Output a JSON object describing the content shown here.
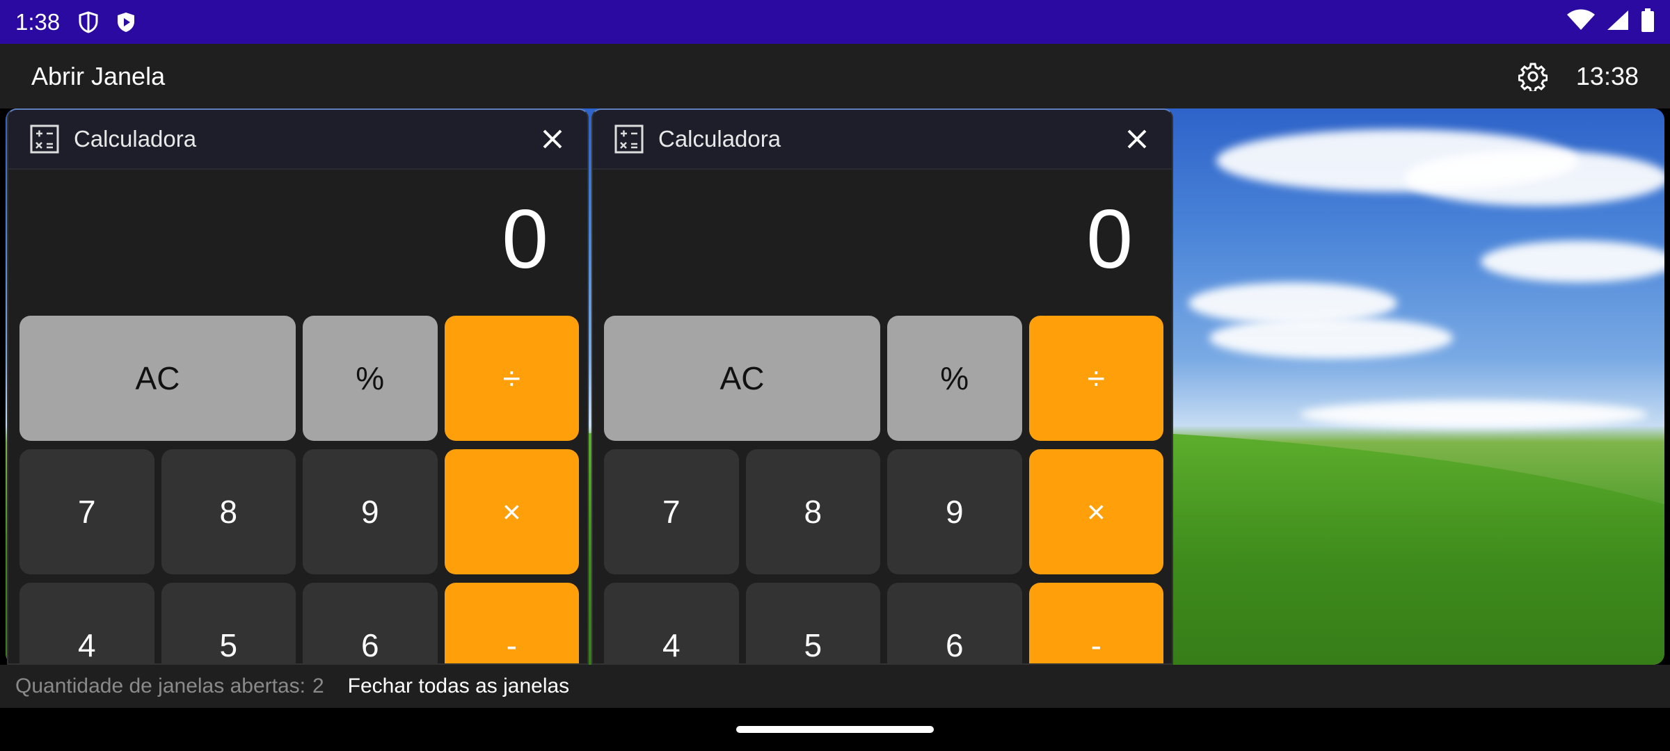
{
  "status_bar": {
    "time": "1:38",
    "icons_left": [
      "shield-icon",
      "play-shield-icon"
    ],
    "icons_right": [
      "wifi-icon",
      "cell-signal-icon",
      "battery-icon"
    ],
    "background": "#2a0aa0"
  },
  "app_bar": {
    "title": "Abrir Janela",
    "clock": "13:38",
    "settings_icon": "gear-icon"
  },
  "windows": [
    {
      "title": "Calculadora",
      "display_value": "0",
      "keys": [
        "AC",
        "%",
        "÷",
        "7",
        "8",
        "9",
        "×",
        "4",
        "5",
        "6",
        "-"
      ]
    },
    {
      "title": "Calculadora",
      "display_value": "0",
      "keys": [
        "AC",
        "%",
        "÷",
        "7",
        "8",
        "9",
        "×",
        "4",
        "5",
        "6",
        "-"
      ]
    }
  ],
  "info_bar": {
    "open_windows_label": "Quantidade de janelas abertas:",
    "open_windows_count": "2",
    "close_all_label": "Fechar todas as janelas"
  },
  "colors": {
    "key_gray": "#a5a5a5",
    "key_dark": "#333333",
    "key_orange": "#ff9f0a"
  }
}
